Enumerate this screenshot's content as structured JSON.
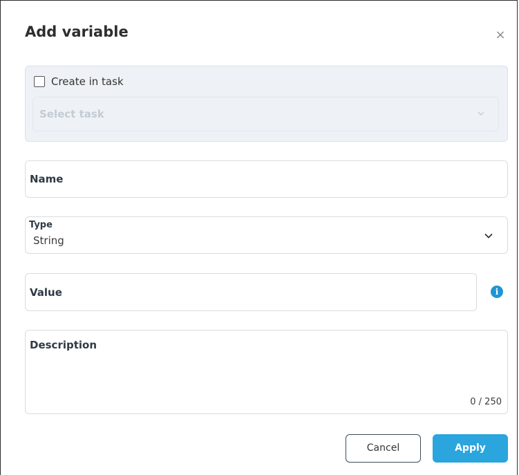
{
  "dialog": {
    "title": "Add variable",
    "close_symbol": "×"
  },
  "task": {
    "checkbox_label": "Create in task",
    "checked": false,
    "select_placeholder": "Select task"
  },
  "fields": {
    "name_label": "Name",
    "type_label": "Type",
    "type_value": "String",
    "value_label": "Value",
    "description_label": "Description",
    "description_counter": "0 / 250"
  },
  "info_icon": {
    "glyph": "i",
    "color": "#1e96d3"
  },
  "buttons": {
    "cancel_label": "Cancel",
    "apply_label": "Apply",
    "apply_color": "#2aa5de"
  }
}
